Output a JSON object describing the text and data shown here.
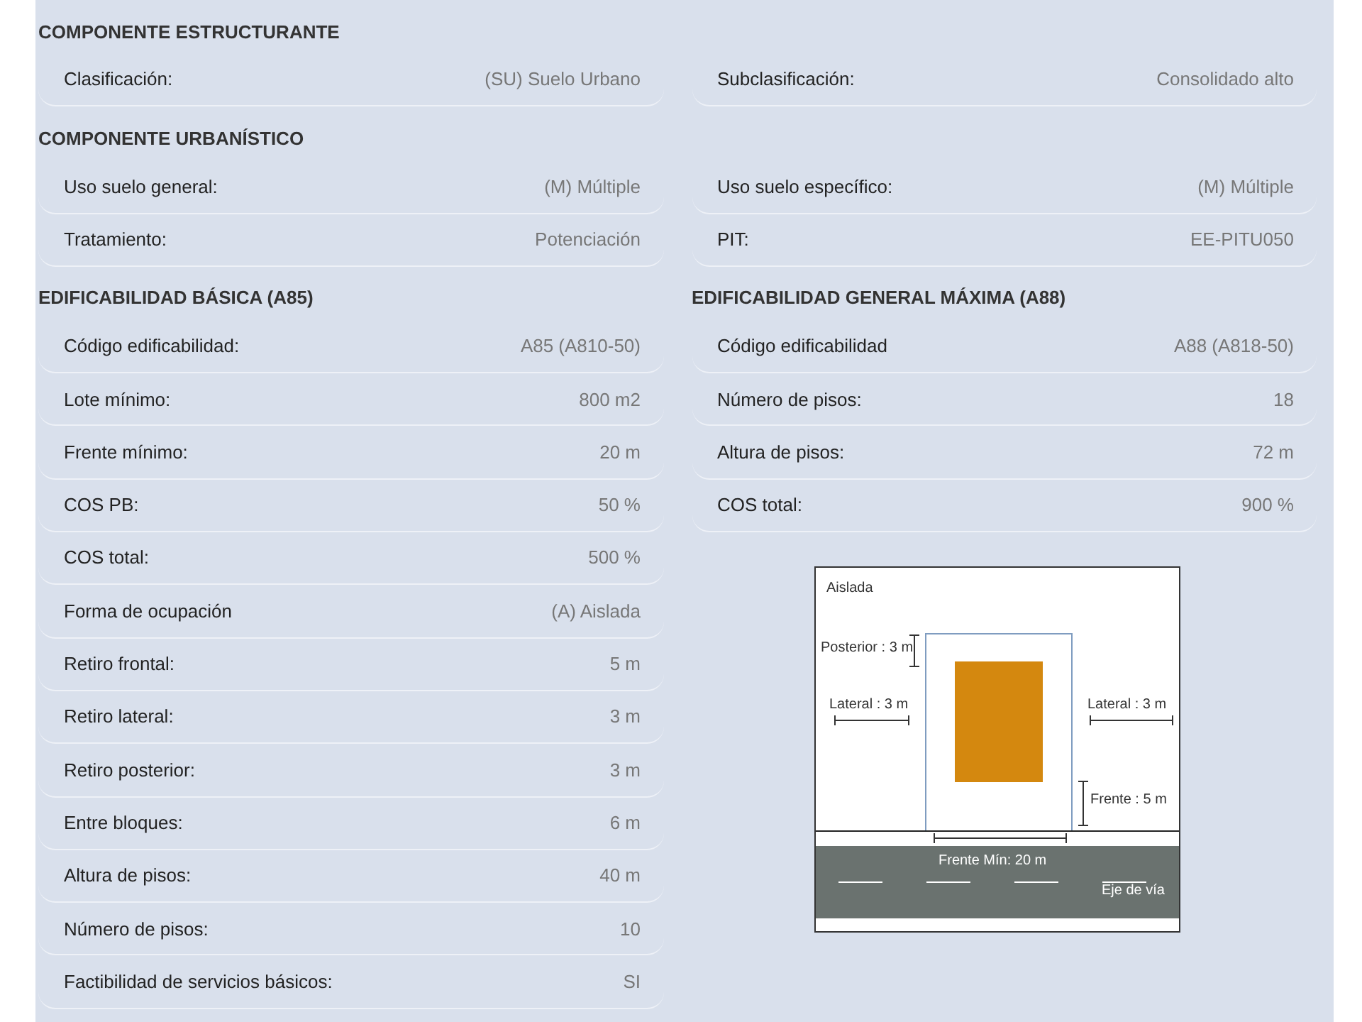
{
  "sections": [
    {
      "title": "COMPONENTE ESTRUCTURANTE",
      "fields": [
        {
          "label": "Clasificación:",
          "value": "(SU) Suelo Urbano"
        },
        {
          "label": "Subclasificación:",
          "value": "Consolidado alto"
        }
      ]
    },
    {
      "title": "COMPONENTE URBANÍSTICO",
      "fields": [
        {
          "label": "Uso suelo general:",
          "value": "(M) Múltiple"
        },
        {
          "label": "Uso suelo específico:",
          "value": "(M) Múltiple"
        },
        {
          "label": "Tratamiento:",
          "value": "Potenciación"
        },
        {
          "label": "PIT:",
          "value": "EE-PITU050"
        }
      ]
    }
  ],
  "edificabilidad_basica": {
    "title": "EDIFICABILIDAD BÁSICA (A85)",
    "fields": [
      {
        "label": "Código edificabilidad:",
        "value": "A85 (A810-50)"
      },
      {
        "label": "Lote mínimo:",
        "value": "800 m2"
      },
      {
        "label": "Frente mínimo:",
        "value": "20 m"
      },
      {
        "label": "COS PB:",
        "value": "50 %"
      },
      {
        "label": "COS total:",
        "value": "500 %"
      },
      {
        "label": "Forma de ocupación",
        "value": "(A) Aislada"
      },
      {
        "label": "Retiro frontal:",
        "value": "5 m"
      },
      {
        "label": "Retiro lateral:",
        "value": "3 m"
      },
      {
        "label": "Retiro posterior:",
        "value": "3 m"
      },
      {
        "label": "Entre bloques:",
        "value": "6 m"
      },
      {
        "label": "Altura de pisos:",
        "value": "40 m"
      },
      {
        "label": "Número de pisos:",
        "value": "10"
      },
      {
        "label": "Factibilidad de servicios básicos:",
        "value": "SI"
      }
    ]
  },
  "edificabilidad_maxima": {
    "title": "EDIFICABILIDAD GENERAL MÁXIMA (A88)",
    "fields": [
      {
        "label": "Código edificabilidad",
        "value": "A88 (A818-50)"
      },
      {
        "label": "Número de pisos:",
        "value": "18"
      },
      {
        "label": "Altura de pisos:",
        "value": "72 m"
      },
      {
        "label": "COS total:",
        "value": "900 %"
      }
    ]
  },
  "diagram": {
    "title": "Aislada",
    "posterior": "Posterior : 3 m",
    "lateral_left": "Lateral : 3 m",
    "lateral_right": "Lateral : 3 m",
    "frente": "Frente : 5 m",
    "frente_min": "Frente Mín: 20 m",
    "eje": "Eje de vía"
  }
}
